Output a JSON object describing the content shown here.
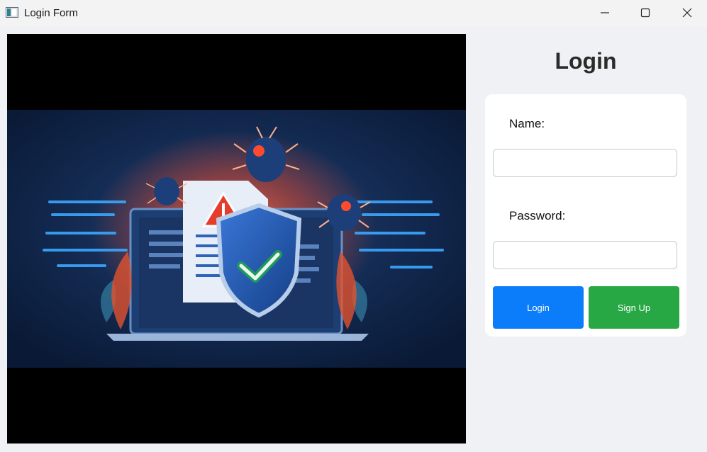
{
  "window": {
    "title": "Login Form",
    "icons": [
      "app-icon",
      "minimize-icon",
      "maximize-icon",
      "close-icon"
    ]
  },
  "form": {
    "heading": "Login",
    "name_label": "Name:",
    "name_value": "",
    "password_label": "Password:",
    "password_value": "",
    "login_button": "Login",
    "signup_button": "Sign Up"
  },
  "colors": {
    "login_button": "#0b7dfb",
    "signup_button": "#28a745",
    "background": "#f0f1f4"
  }
}
